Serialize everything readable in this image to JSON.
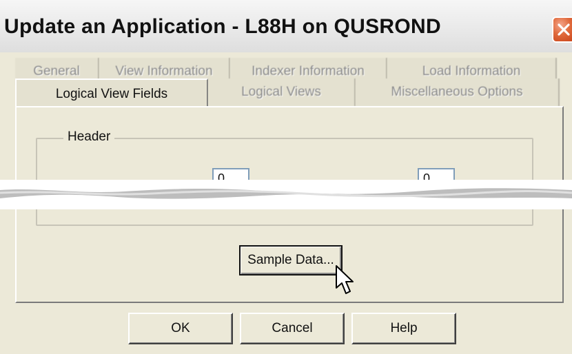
{
  "window": {
    "title": "Update an Application - L88H on QUSROND"
  },
  "tabs": {
    "back_row": [
      "General",
      "View Information",
      "Indexer Information",
      "Load Information"
    ],
    "front_row": [
      "Logical View Fields",
      "Logical Views",
      "Miscellaneous Options"
    ],
    "active": "Logical View Fields"
  },
  "header_group": {
    "label": "Header",
    "field_1_value": "0",
    "field_2_value": "0"
  },
  "buttons": {
    "sample_data": "Sample Data...",
    "ok": "OK",
    "cancel": "Cancel",
    "help": "Help"
  },
  "colors": {
    "dialog_bg": "#ece9d8",
    "close_button": "#e06a3c"
  },
  "icons": {
    "close": "close-x-icon",
    "cursor": "mouse-pointer-icon"
  }
}
